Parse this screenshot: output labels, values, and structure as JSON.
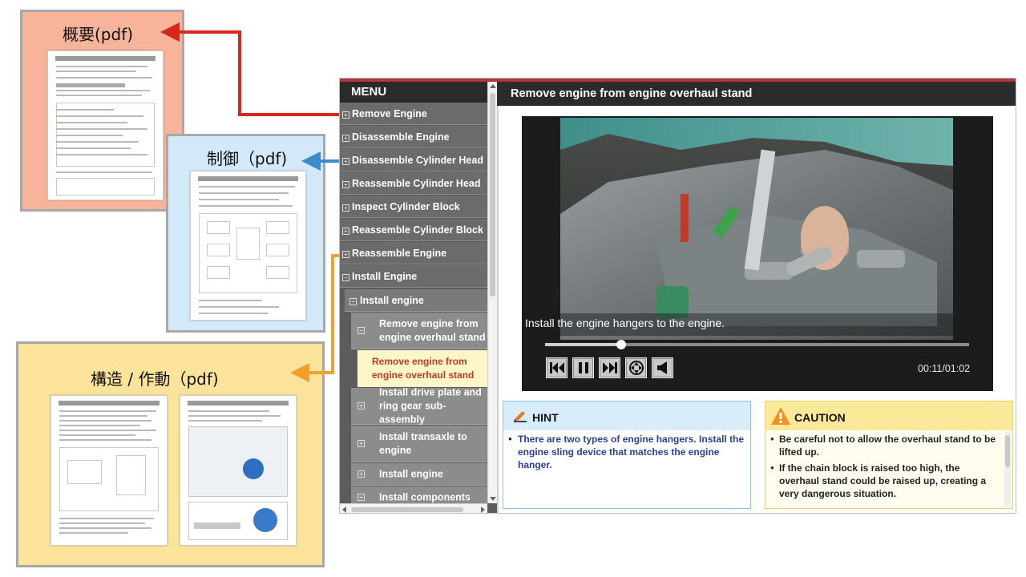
{
  "callouts": {
    "overview": {
      "title": "概要(pdf)",
      "color": "#f7b49a"
    },
    "control": {
      "title": "制御（pdf)",
      "color": "#d3e8f8"
    },
    "structure": {
      "title": "構造 / 作動（pdf)",
      "color": "#fbe49a"
    }
  },
  "arrow_colors": {
    "overview": "#d9261c",
    "control": "#3a8ccb",
    "structure": "#f0a030"
  },
  "app": {
    "menu": {
      "header": "MENU",
      "items": [
        {
          "label": "Remove Engine",
          "icon": "plus-box-icon"
        },
        {
          "label": "Disassemble Engine",
          "icon": "plus-box-icon"
        },
        {
          "label": "Disassemble Cylinder Head",
          "icon": "plus-box-icon"
        },
        {
          "label": "Reassemble Cylinder Head",
          "icon": "plus-box-icon"
        },
        {
          "label": "Inspect Cylinder Block",
          "icon": "plus-box-icon"
        },
        {
          "label": "Reassemble Cylinder Block",
          "icon": "plus-box-icon"
        },
        {
          "label": "Reassemble Engine",
          "icon": "plus-box-icon"
        },
        {
          "label": "Install Engine",
          "icon": "minus-box-icon"
        }
      ],
      "submenu_label": "Install engine",
      "subitems": [
        {
          "label": "Remove engine from engine overhaul stand",
          "icon": "minus-box-icon"
        },
        {
          "label": "Install drive plate and ring gear sub-assembly",
          "icon": "plus-box-icon"
        },
        {
          "label": "Install transaxle to engine",
          "icon": "plus-box-icon"
        },
        {
          "label": "Install engine",
          "icon": "plus-box-icon"
        },
        {
          "label": "Install components",
          "icon": "plus-box-icon"
        }
      ],
      "selected_leaf": "Remove engine from engine overhaul stand",
      "expand_icon": "+",
      "collapse_icon": "−"
    },
    "content_title": "Remove engine from engine overhaul stand",
    "video": {
      "caption": "Install the engine hangers to the engine.",
      "time": "00:11/01:02",
      "progress": 0.18,
      "controls": [
        "skip-back-icon",
        "pause-icon",
        "skip-forward-icon",
        "fullscreen-icon",
        "volume-icon"
      ]
    },
    "hint": {
      "label": "HINT",
      "text": "There are two types of engine hangers. Install the engine sling device that matches the engine hanger."
    },
    "caution": {
      "label": "CAUTION",
      "items": [
        "Be careful not to allow the overhaul stand to be lifted up.",
        "If the chain block is raised too high, the overhaul stand could be raised up, creating a very dangerous situation."
      ]
    }
  }
}
